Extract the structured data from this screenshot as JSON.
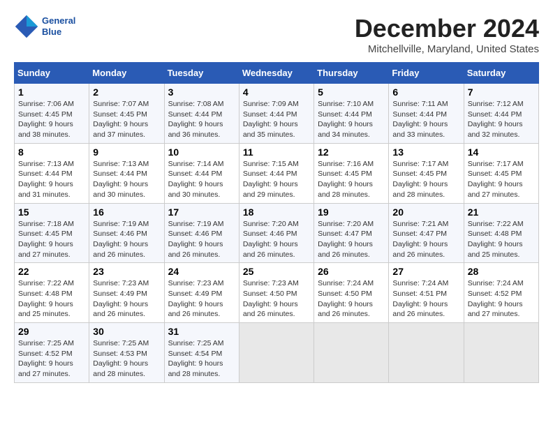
{
  "header": {
    "logo_line1": "General",
    "logo_line2": "Blue",
    "month": "December 2024",
    "location": "Mitchellville, Maryland, United States"
  },
  "weekdays": [
    "Sunday",
    "Monday",
    "Tuesday",
    "Wednesday",
    "Thursday",
    "Friday",
    "Saturday"
  ],
  "weeks": [
    [
      {
        "day": "1",
        "info": "Sunrise: 7:06 AM\nSunset: 4:45 PM\nDaylight: 9 hours\nand 38 minutes."
      },
      {
        "day": "2",
        "info": "Sunrise: 7:07 AM\nSunset: 4:45 PM\nDaylight: 9 hours\nand 37 minutes."
      },
      {
        "day": "3",
        "info": "Sunrise: 7:08 AM\nSunset: 4:44 PM\nDaylight: 9 hours\nand 36 minutes."
      },
      {
        "day": "4",
        "info": "Sunrise: 7:09 AM\nSunset: 4:44 PM\nDaylight: 9 hours\nand 35 minutes."
      },
      {
        "day": "5",
        "info": "Sunrise: 7:10 AM\nSunset: 4:44 PM\nDaylight: 9 hours\nand 34 minutes."
      },
      {
        "day": "6",
        "info": "Sunrise: 7:11 AM\nSunset: 4:44 PM\nDaylight: 9 hours\nand 33 minutes."
      },
      {
        "day": "7",
        "info": "Sunrise: 7:12 AM\nSunset: 4:44 PM\nDaylight: 9 hours\nand 32 minutes."
      }
    ],
    [
      {
        "day": "8",
        "info": "Sunrise: 7:13 AM\nSunset: 4:44 PM\nDaylight: 9 hours\nand 31 minutes."
      },
      {
        "day": "9",
        "info": "Sunrise: 7:13 AM\nSunset: 4:44 PM\nDaylight: 9 hours\nand 30 minutes."
      },
      {
        "day": "10",
        "info": "Sunrise: 7:14 AM\nSunset: 4:44 PM\nDaylight: 9 hours\nand 30 minutes."
      },
      {
        "day": "11",
        "info": "Sunrise: 7:15 AM\nSunset: 4:44 PM\nDaylight: 9 hours\nand 29 minutes."
      },
      {
        "day": "12",
        "info": "Sunrise: 7:16 AM\nSunset: 4:45 PM\nDaylight: 9 hours\nand 28 minutes."
      },
      {
        "day": "13",
        "info": "Sunrise: 7:17 AM\nSunset: 4:45 PM\nDaylight: 9 hours\nand 28 minutes."
      },
      {
        "day": "14",
        "info": "Sunrise: 7:17 AM\nSunset: 4:45 PM\nDaylight: 9 hours\nand 27 minutes."
      }
    ],
    [
      {
        "day": "15",
        "info": "Sunrise: 7:18 AM\nSunset: 4:45 PM\nDaylight: 9 hours\nand 27 minutes."
      },
      {
        "day": "16",
        "info": "Sunrise: 7:19 AM\nSunset: 4:46 PM\nDaylight: 9 hours\nand 26 minutes."
      },
      {
        "day": "17",
        "info": "Sunrise: 7:19 AM\nSunset: 4:46 PM\nDaylight: 9 hours\nand 26 minutes."
      },
      {
        "day": "18",
        "info": "Sunrise: 7:20 AM\nSunset: 4:46 PM\nDaylight: 9 hours\nand 26 minutes."
      },
      {
        "day": "19",
        "info": "Sunrise: 7:20 AM\nSunset: 4:47 PM\nDaylight: 9 hours\nand 26 minutes."
      },
      {
        "day": "20",
        "info": "Sunrise: 7:21 AM\nSunset: 4:47 PM\nDaylight: 9 hours\nand 26 minutes."
      },
      {
        "day": "21",
        "info": "Sunrise: 7:22 AM\nSunset: 4:48 PM\nDaylight: 9 hours\nand 25 minutes."
      }
    ],
    [
      {
        "day": "22",
        "info": "Sunrise: 7:22 AM\nSunset: 4:48 PM\nDaylight: 9 hours\nand 25 minutes."
      },
      {
        "day": "23",
        "info": "Sunrise: 7:23 AM\nSunset: 4:49 PM\nDaylight: 9 hours\nand 26 minutes."
      },
      {
        "day": "24",
        "info": "Sunrise: 7:23 AM\nSunset: 4:49 PM\nDaylight: 9 hours\nand 26 minutes."
      },
      {
        "day": "25",
        "info": "Sunrise: 7:23 AM\nSunset: 4:50 PM\nDaylight: 9 hours\nand 26 minutes."
      },
      {
        "day": "26",
        "info": "Sunrise: 7:24 AM\nSunset: 4:50 PM\nDaylight: 9 hours\nand 26 minutes."
      },
      {
        "day": "27",
        "info": "Sunrise: 7:24 AM\nSunset: 4:51 PM\nDaylight: 9 hours\nand 26 minutes."
      },
      {
        "day": "28",
        "info": "Sunrise: 7:24 AM\nSunset: 4:52 PM\nDaylight: 9 hours\nand 27 minutes."
      }
    ],
    [
      {
        "day": "29",
        "info": "Sunrise: 7:25 AM\nSunset: 4:52 PM\nDaylight: 9 hours\nand 27 minutes."
      },
      {
        "day": "30",
        "info": "Sunrise: 7:25 AM\nSunset: 4:53 PM\nDaylight: 9 hours\nand 28 minutes."
      },
      {
        "day": "31",
        "info": "Sunrise: 7:25 AM\nSunset: 4:54 PM\nDaylight: 9 hours\nand 28 minutes."
      },
      {
        "day": "",
        "info": ""
      },
      {
        "day": "",
        "info": ""
      },
      {
        "day": "",
        "info": ""
      },
      {
        "day": "",
        "info": ""
      }
    ]
  ]
}
